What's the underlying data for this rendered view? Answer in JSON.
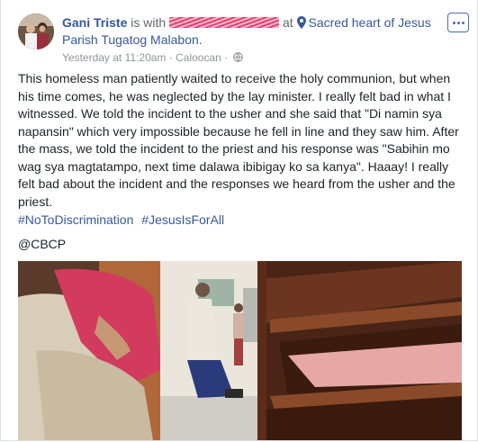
{
  "post": {
    "author": "Gani Triste",
    "with_text": "is with",
    "at_text": "at",
    "location_line1": "Sacred heart of Jesus",
    "location_line2": "Parish Tugatog Malabon.",
    "timestamp": "Yesterday at 11:20am",
    "separator": "·",
    "place": "Caloocan",
    "privacy_icon": "globe-icon",
    "location_icon": "map-pin-icon",
    "more_icon": "more-options-icon",
    "body": "This homeless man patiently waited to receive the holy communion, but when his time comes, he was neglected by the lay minister. I really felt bad in what I witnessed. We told the incident to the usher and she said that \"Di namin sya napansin\" which very impossible because he fell in line and they saw him. After the mass, we told the incident to the priest and his response was \"Sabihin mo wag sya magtatampo, next time dalawa ibibigay ko sa kanya\". Haaay! I really felt bad about the incident and the responses we heard from the usher and the priest.",
    "hashtags": [
      "#NoToDiscrimination",
      "#JesusIsForAll"
    ],
    "mention": "@CBCP"
  },
  "colors": {
    "link": "#365899",
    "text": "#1d2129",
    "muted": "#90949c",
    "redaction": "#e0416f"
  }
}
